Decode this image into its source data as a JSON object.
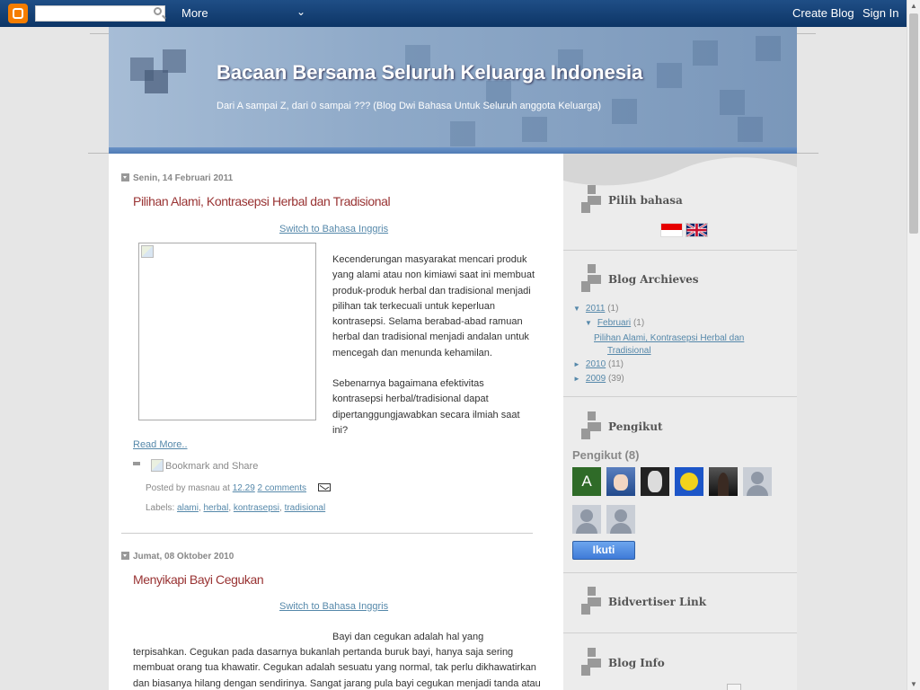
{
  "navbar": {
    "more_label": "More",
    "create_blog_label": "Create Blog",
    "sign_in_label": "Sign In"
  },
  "header": {
    "title": "Bacaan Bersama Seluruh Keluarga Indonesia",
    "description": "Dari A sampai Z, dari 0 sampai ??? (Blog Dwi Bahasa Untuk Seluruh anggota Keluarga)"
  },
  "posts": [
    {
      "date": "Senin, 14 Februari 2011",
      "title": "Pilihan Alami, Kontrasepsi Herbal dan Tradisional",
      "switch_label": "Switch to Bahasa Inggris",
      "body_lines": [
        "Kecenderungan masyarakat mencari produk",
        "yang alami atau non kimiawi saat ini membuat",
        "produk-produk herbal dan tradisional menjadi",
        "pilihan tak terkecuali untuk keperluan",
        "kontrasepsi. Selama berabad-abad ramuan",
        "herbal dan tradisional menjadi andalan untuk",
        "mencegah dan menunda kehamilan."
      ],
      "body2_lines": [
        "Sebenarnya bagaimana efektivitas",
        "kontrasepsi herbal/tradisional dapat",
        "dipertanggungjawabkan secara ilmiah saat",
        "ini?"
      ],
      "read_more": "Read More..",
      "bookmark_label": "Bookmark and Share",
      "posted_by_prefix": "Posted by masnau at",
      "time": "12.29",
      "comments": "2 comments",
      "labels_prefix": "Labels:",
      "labels": [
        "alami",
        "herbal",
        "kontrasepsi",
        "tradisional"
      ]
    },
    {
      "date": "Jumat, 08 Oktober 2010",
      "title": "Menyikapi Bayi Cegukan",
      "switch_label": "Switch to Bahasa Inggris",
      "body_first_line": "Bayi dan cegukan adalah hal yang",
      "body_lines": [
        "terpisahkan. Cegukan pada dasarnya bukanlah pertanda buruk bayi, hanya saja sering",
        "membuat orang tua khawatir. Cegukan adalah sesuatu yang normal, tak perlu dikhawatirkan",
        "dan biasanya hilang dengan sendirinya. Sangat jarang pula bayi cegukan menjadi tanda atau"
      ]
    }
  ],
  "sidebar": {
    "language_title": "Pilih bahasa",
    "archive_title": "Blog Archieves",
    "archive": [
      {
        "toggle": "▼",
        "label": "2011",
        "count": "(1)"
      },
      {
        "toggle": "▼",
        "label": "Februari",
        "count": "(1)"
      },
      {
        "post_line1": "Pilihan Alami, Kontrasepsi Herbal dan",
        "post_line2": "Tradisional"
      },
      {
        "toggle": "►",
        "label": "2010",
        "count": "(11)"
      },
      {
        "toggle": "►",
        "label": "2009",
        "count": "(39)"
      }
    ],
    "followers_title": "Pengikut",
    "followers_label": "Pengikut (8)",
    "follower_first_initial": "A",
    "follow_button": "Ikuti",
    "bidvertiser_title": "Bidvertiser Link",
    "blog_info_title": "Blog Info"
  }
}
